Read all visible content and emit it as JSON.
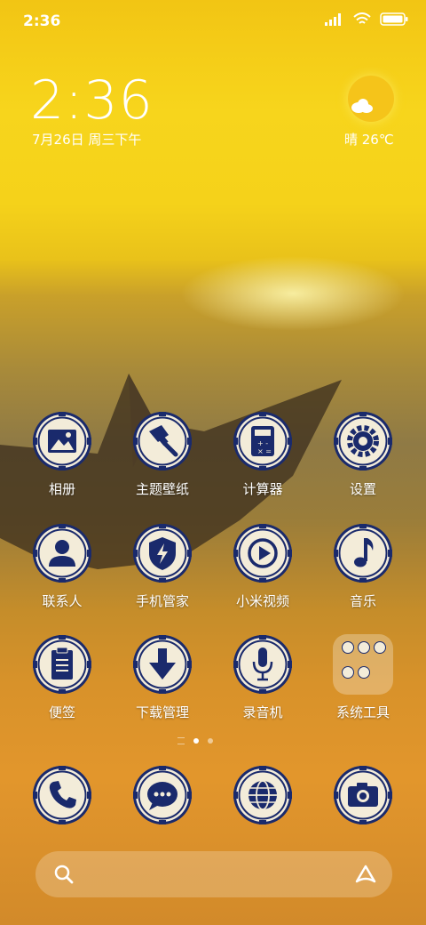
{
  "status_bar": {
    "time": "2:36",
    "icons": [
      "signal-icon",
      "wifi-icon",
      "battery-icon"
    ]
  },
  "clock_widget": {
    "time": "2:36",
    "date": "7月26日 周三下午"
  },
  "weather_widget": {
    "text": "晴 26℃",
    "icon": "partly-cloudy-icon"
  },
  "apps": [
    {
      "label": "相册",
      "icon": "gallery-icon"
    },
    {
      "label": "主题壁纸",
      "icon": "paintbrush-icon"
    },
    {
      "label": "计算器",
      "icon": "calculator-icon"
    },
    {
      "label": "设置",
      "icon": "gear-icon"
    },
    {
      "label": "联系人",
      "icon": "person-icon"
    },
    {
      "label": "手机管家",
      "icon": "shield-bolt-icon"
    },
    {
      "label": "小米视频",
      "icon": "play-icon"
    },
    {
      "label": "音乐",
      "icon": "music-note-icon"
    },
    {
      "label": "便签",
      "icon": "notepad-icon"
    },
    {
      "label": "下载管理",
      "icon": "download-arrow-icon"
    },
    {
      "label": "录音机",
      "icon": "microphone-icon"
    },
    {
      "label": "系统工具",
      "icon": "folder-icon"
    }
  ],
  "page_indicator": {
    "pages": 2,
    "active": 1
  },
  "dock": [
    {
      "icon": "phone-icon"
    },
    {
      "icon": "message-icon"
    },
    {
      "icon": "globe-icon"
    },
    {
      "icon": "camera-icon"
    }
  ],
  "search_bar": {
    "left_icon": "search-icon",
    "right_icon": "assistant-icon"
  },
  "colors": {
    "icon_ring": "#1a2a6c",
    "icon_fill": "#f3ecd9"
  }
}
